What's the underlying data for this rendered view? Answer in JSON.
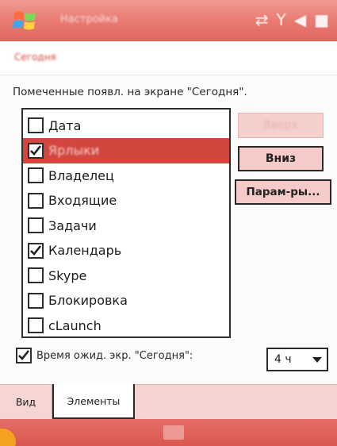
{
  "titlebar": {
    "title": "Настройка",
    "start_icon": "windows-flag-icon",
    "status_icons": [
      "connectivity-icon",
      "signal-icon",
      "volume-icon",
      "close-icon"
    ]
  },
  "subheader": {
    "title": "Сегодня"
  },
  "description": "Помеченные появл. на экране \"Сегодня\".",
  "items": [
    {
      "label": "Дата",
      "checked": false,
      "selected": false
    },
    {
      "label": "Ярлыки",
      "checked": true,
      "selected": true
    },
    {
      "label": "Владелец",
      "checked": false,
      "selected": false
    },
    {
      "label": "Входящие",
      "checked": false,
      "selected": false
    },
    {
      "label": "Задачи",
      "checked": false,
      "selected": false
    },
    {
      "label": "Календарь",
      "checked": true,
      "selected": false
    },
    {
      "label": "Skype",
      "checked": false,
      "selected": false
    },
    {
      "label": "Блокировка",
      "checked": false,
      "selected": false
    },
    {
      "label": "cLaunch",
      "checked": false,
      "selected": false
    }
  ],
  "buttons": {
    "up": "Вверх",
    "down": "Вниз",
    "params": "Парам-ры..."
  },
  "timeout": {
    "checked": true,
    "label": "Время ожид. экр. \"Сегодня\":",
    "value": "4 ч"
  },
  "tabs": [
    {
      "label": "Вид",
      "active": false
    },
    {
      "label": "Элементы",
      "active": true
    }
  ],
  "colors": {
    "accent": "#d2463f",
    "titlebar": "#e8786f",
    "tab_bar": "#f4d3d0"
  }
}
